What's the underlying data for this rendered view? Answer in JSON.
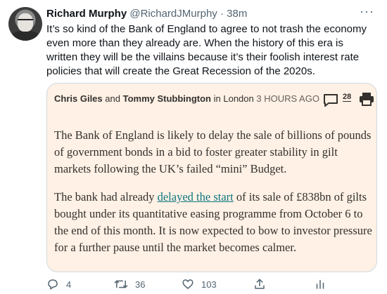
{
  "author": {
    "name": "Richard Murphy",
    "handle": "@RichardJMurphy",
    "separator": "·",
    "time": "38m"
  },
  "more_menu_label": "···",
  "tweet": {
    "text": "It’s so kind of the Bank of England to agree to not trash the economy even more than they already are. When the history of this era is written they will be the villains because it’s their foolish interest rate policies that will create the Great Recession of the 2020s."
  },
  "card": {
    "author1": "Chris Giles",
    "and": "and",
    "author2": "Tommy Stubbington",
    "location": "in London",
    "time": "3 HOURS AGO",
    "comment_count": "28",
    "paragraph1": "The Bank of England is likely to delay the sale of billions of pounds of government bonds in a bid to foster greater stability in gilt markets following the UK’s failed “mini” Budget.",
    "paragraph2_before": "The bank had already ",
    "paragraph2_link": "delayed the start",
    "paragraph2_after": " of its sale of £838bn of gilts bought under its quantitative easing programme from October 6 to the end of this month. It is now expected to bow to investor pressure for a further pause until the market becomes calmer.",
    "background_color": "#fff1e5",
    "link_color": "#0d7680"
  },
  "actions": {
    "replies": "4",
    "retweets": "36",
    "likes": "103"
  },
  "colors": {
    "text": "#0f1419",
    "secondary": "#536471",
    "border": "#cfd9de"
  }
}
